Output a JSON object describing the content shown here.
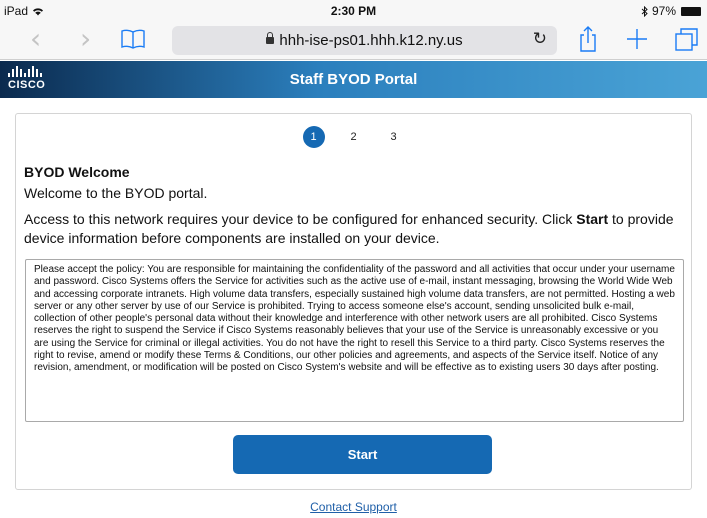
{
  "status_bar": {
    "device": "iPad",
    "time": "2:30 PM",
    "battery": "97%"
  },
  "browser": {
    "url": "hhh-ise-ps01.hhh.k12.ny.us",
    "back_icon": "chevron-left",
    "forward_icon": "chevron-right",
    "bookmarks_icon": "book",
    "reload_icon": "reload",
    "share_icon": "share",
    "new_tab_icon": "plus",
    "tabs_icon": "tabs"
  },
  "header": {
    "logo_text": "CISCO",
    "title": "Staff BYOD Portal"
  },
  "steps": [
    "1",
    "2",
    "3"
  ],
  "main": {
    "title": "BYOD Welcome",
    "subtitle": "Welcome to the BYOD portal.",
    "access_before": "Access to this network requires your device to be configured for enhanced security. Click ",
    "access_bold": "Start",
    "access_after": " to provide device information before components are installed on your device.",
    "policy_text": "Please accept the policy: You are responsible for maintaining the confidentiality of the password and all activities that occur under your username and password. Cisco Systems offers the Service for activities such as the active use of e-mail, instant messaging, browsing the World Wide Web and accessing corporate intranets. High volume data transfers, especially sustained high volume data transfers, are not permitted. Hosting a web server or any other server by use of our Service is prohibited. Trying to access someone else's account, sending unsolicited bulk e-mail, collection of other people's personal data without their knowledge and interference with other network users are all prohibited. Cisco Systems reserves the right to suspend the Service if Cisco Systems reasonably believes that your use of the Service is unreasonably excessive or you are using the Service for criminal or illegal activities. You do not have the right to resell this Service to a third party. Cisco Systems reserves the right to revise, amend or modify these Terms & Conditions, our other policies and agreements, and aspects of the Service itself. Notice of any revision, amendment, or modification will be posted on Cisco System's website and will be effective as to existing users 30 days after posting.",
    "start_label": "Start"
  },
  "footer": {
    "contact_label": "Contact Support"
  },
  "colors": {
    "accent": "#1569b3",
    "link": "#1f5fa8"
  }
}
